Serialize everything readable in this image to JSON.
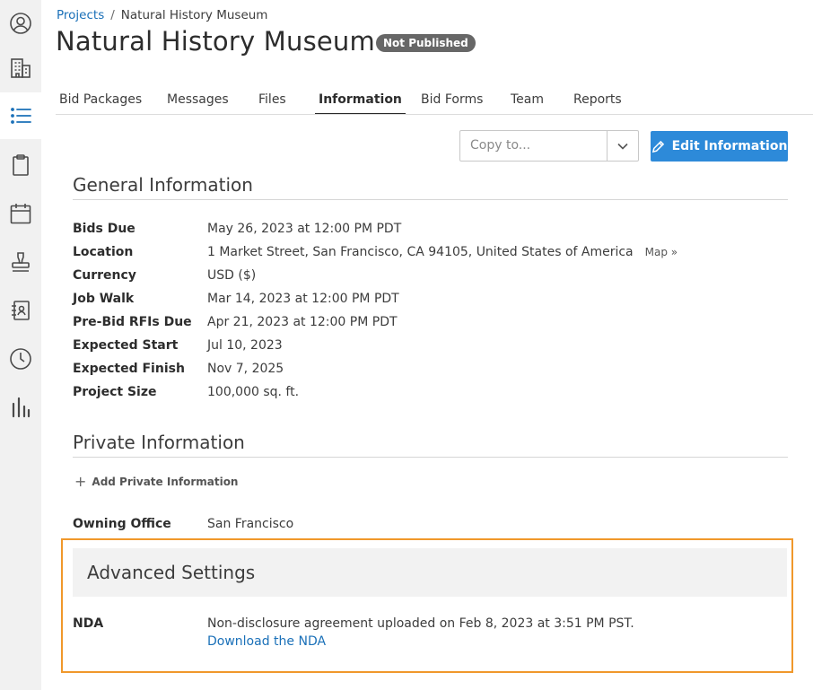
{
  "rail": {
    "items": [
      {
        "name": "user-icon",
        "active": false
      },
      {
        "name": "building-icon",
        "active": false
      },
      {
        "name": "list-icon",
        "active": true
      },
      {
        "name": "clipboard-icon",
        "active": false
      },
      {
        "name": "calendar-icon",
        "active": false
      },
      {
        "name": "stamp-icon",
        "active": false
      },
      {
        "name": "address-book-icon",
        "active": false
      },
      {
        "name": "clock-icon",
        "active": false
      },
      {
        "name": "bar-chart-icon",
        "active": false
      }
    ],
    "accent": "#1a70b8"
  },
  "breadcrumb": {
    "root": "Projects",
    "separator": "/",
    "current": "Natural History Museum"
  },
  "header": {
    "title": "Natural History Museum",
    "status": "Not Published"
  },
  "tabs": [
    {
      "label": "Bid Packages",
      "active": false
    },
    {
      "label": "Messages",
      "active": false
    },
    {
      "label": "Files",
      "active": false
    },
    {
      "label": "Information",
      "active": true
    },
    {
      "label": "Bid Forms",
      "active": false
    },
    {
      "label": "Team",
      "active": false
    },
    {
      "label": "Reports",
      "active": false
    }
  ],
  "toolbar": {
    "copy_placeholder": "Copy to...",
    "edit_label": "Edit Information"
  },
  "general": {
    "title": "General Information",
    "fields": [
      {
        "label": "Bids Due",
        "value": "May 26, 2023 at 12:00 PM PDT"
      },
      {
        "label": "Location",
        "value": "1 Market Street, San Francisco, CA 94105, United States of America",
        "link": "Map »"
      },
      {
        "label": "Currency",
        "value": "USD ($)"
      },
      {
        "label": "Job Walk",
        "value": "Mar 14, 2023 at 12:00 PM PDT"
      },
      {
        "label": "Pre-Bid RFIs Due",
        "value": "Apr 21, 2023 at 12:00 PM PDT"
      },
      {
        "label": "Expected Start",
        "value": "Jul 10, 2023"
      },
      {
        "label": "Expected Finish",
        "value": "Nov 7, 2025"
      },
      {
        "label": "Project Size",
        "value": "100,000 sq. ft."
      }
    ]
  },
  "private": {
    "title": "Private Information",
    "add_label": "Add Private Information",
    "owning_office_label": "Owning Office",
    "owning_office_value": "San Francisco"
  },
  "advanced": {
    "title": "Advanced Settings",
    "nda_label": "NDA",
    "nda_text": "Non-disclosure agreement uploaded on Feb 8, 2023 at 3:51 PM PST.",
    "nda_link": "Download the NDA",
    "highlight_color": "#f0982b"
  },
  "colors": {
    "primary_button": "#2d8ad9",
    "link": "#1a70b8",
    "badge": "#676767"
  }
}
